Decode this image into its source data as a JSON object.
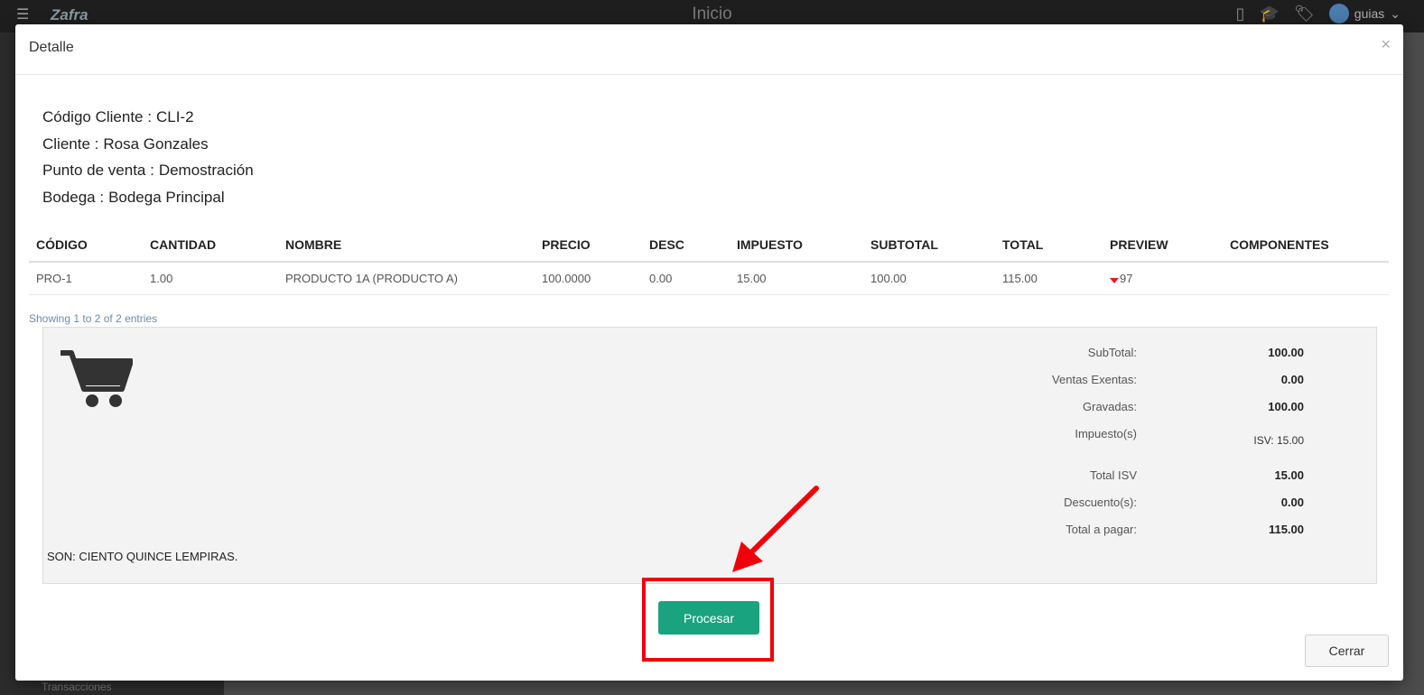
{
  "app": {
    "title": "Inicio",
    "logo": "Zafra",
    "user": "guias",
    "sidebar_bottom_text": "Transacciones"
  },
  "modal": {
    "title": "Detalle",
    "close": "×",
    "info": [
      {
        "label": "Código Cliente :",
        "value": "CLI-2"
      },
      {
        "label": "Cliente :",
        "value": "Rosa Gonzales"
      },
      {
        "label": "Punto de venta :",
        "value": "Demostración"
      },
      {
        "label": "Bodega :",
        "value": "Bodega Principal"
      }
    ],
    "table": {
      "headers": [
        "CÓDIGO",
        "CANTIDAD",
        "NOMBRE",
        "PRECIO",
        "DESC",
        "IMPUESTO",
        "SUBTOTAL",
        "TOTAL",
        "PREVIEW",
        "COMPONENTES"
      ],
      "rows": [
        {
          "codigo": "PRO-1",
          "cantidad": "1.00",
          "nombre": "PRODUCTO 1A (PRODUCTO A)",
          "precio": "100.0000",
          "desc": "0.00",
          "impuesto": "15.00",
          "subtotal": "100.00",
          "total": "115.00",
          "preview": "97",
          "componentes": ""
        }
      ],
      "showing": "Showing 1 to 2 of 2 entries"
    },
    "summary": {
      "subtotal_label": "SubTotal:",
      "subtotal": "100.00",
      "exentas_label": "Ventas Exentas:",
      "exentas": "0.00",
      "gravadas_label": "Gravadas:",
      "gravadas": "100.00",
      "impuestos_label": "Impuesto(s)",
      "impuestos": "ISV: 15.00",
      "total_isv_label": "Total ISV",
      "total_isv": "15.00",
      "descuentos_label": "Descuento(s):",
      "descuentos": "0.00",
      "total_pagar_label": "Total a pagar:",
      "total_pagar": "115.00",
      "son": "SON: CIENTO QUINCE LEMPIRAS."
    },
    "buttons": {
      "procesar": "Procesar",
      "cerrar": "Cerrar"
    }
  },
  "colors": {
    "primary_button": "#1aa37f",
    "annotation": "#f0000a"
  },
  "icons": [
    "menu-icon",
    "phone-icon",
    "graduation-cap-icon",
    "tags-icon",
    "user-avatar-icon",
    "chevron-down-icon",
    "shopping-cart-icon",
    "caret-down-icon"
  ]
}
